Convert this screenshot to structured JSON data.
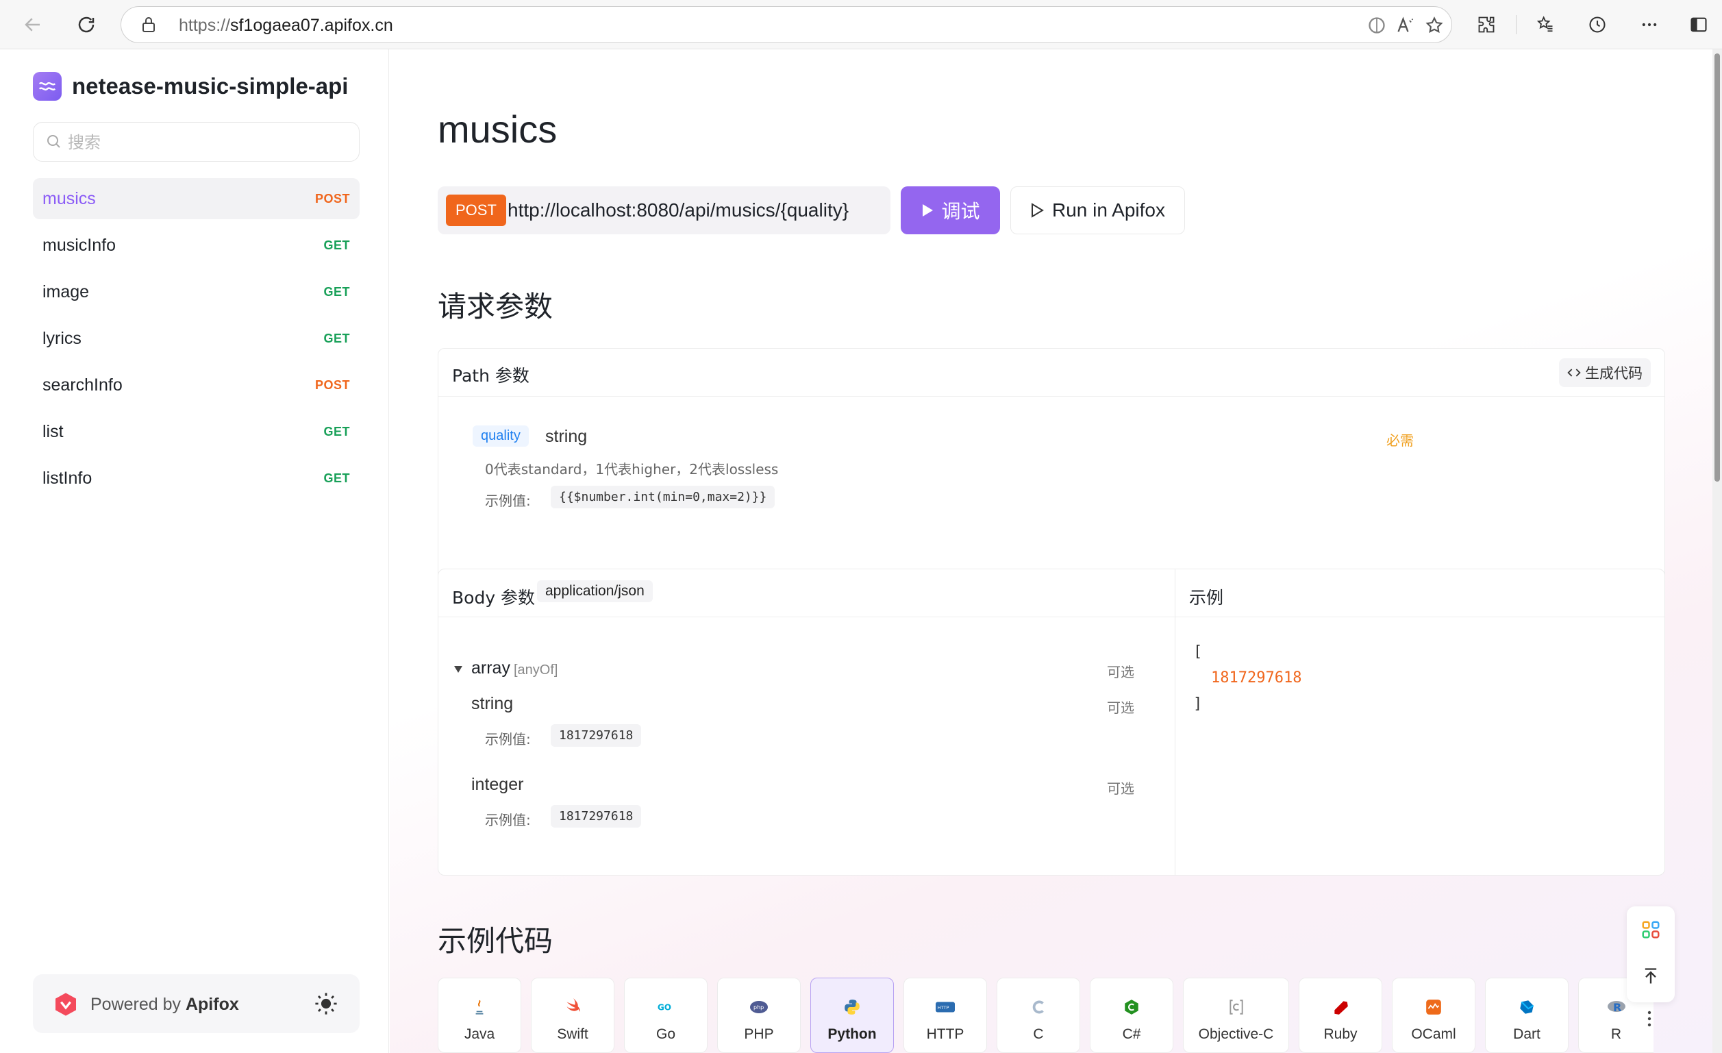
{
  "browser": {
    "url_protocol": "https://",
    "url_host": "sf1ogaea07.apifox.cn"
  },
  "sidebar": {
    "project_name": "netease-music-simple-api",
    "search_placeholder": "搜索",
    "items": [
      {
        "label": "musics",
        "method": "POST",
        "active": true
      },
      {
        "label": "musicInfo",
        "method": "GET",
        "active": false
      },
      {
        "label": "image",
        "method": "GET",
        "active": false
      },
      {
        "label": "lyrics",
        "method": "GET",
        "active": false
      },
      {
        "label": "searchInfo",
        "method": "POST",
        "active": false
      },
      {
        "label": "list",
        "method": "GET",
        "active": false
      },
      {
        "label": "listInfo",
        "method": "GET",
        "active": false
      }
    ],
    "powered_prefix": "Powered by",
    "powered_brand": "Apifox"
  },
  "main": {
    "title": "musics",
    "method": "POST",
    "endpoint": "http://localhost:8080/api/musics/{quality}",
    "debug_label": "调试",
    "run_label": "Run in Apifox",
    "request_params_title": "请求参数",
    "path_params": {
      "title": "Path 参数",
      "gen_code_label": "生成代码",
      "param": {
        "name": "quality",
        "type": "string",
        "required_label": "必需",
        "description": "0代表standard，1代表higher，2代表lossless",
        "example_label": "示例值:",
        "example": "{{$number.int(min=0,max=2)}}"
      }
    },
    "body_params": {
      "title": "Body 参数",
      "content_type": "application/json",
      "root_type": "array",
      "root_qualifier": "[anyOf]",
      "optional_label": "可选",
      "variants": [
        {
          "type": "string",
          "example_label": "示例值:",
          "example": "1817297618"
        },
        {
          "type": "integer",
          "example_label": "示例值:",
          "example": "1817297618"
        }
      ]
    },
    "example_panel": {
      "title": "示例",
      "open_bracket": "[",
      "value": "1817297618",
      "close_bracket": "]"
    },
    "code_examples_title": "示例代码",
    "languages": [
      {
        "name": "Java",
        "active": false
      },
      {
        "name": "Swift",
        "active": false
      },
      {
        "name": "Go",
        "active": false
      },
      {
        "name": "PHP",
        "active": false
      },
      {
        "name": "Python",
        "active": true
      },
      {
        "name": "HTTP",
        "active": false
      },
      {
        "name": "C",
        "active": false
      },
      {
        "name": "C#",
        "active": false
      },
      {
        "name": "Objective-C",
        "active": false
      },
      {
        "name": "Ruby",
        "active": false
      },
      {
        "name": "OCaml",
        "active": false
      },
      {
        "name": "Dart",
        "active": false
      },
      {
        "name": "R",
        "active": false
      }
    ]
  },
  "colors": {
    "accent": "#9466ef",
    "post": "#f0661c",
    "get": "#18a058",
    "required": "#f0a020",
    "param_blue": "#2080f0"
  }
}
